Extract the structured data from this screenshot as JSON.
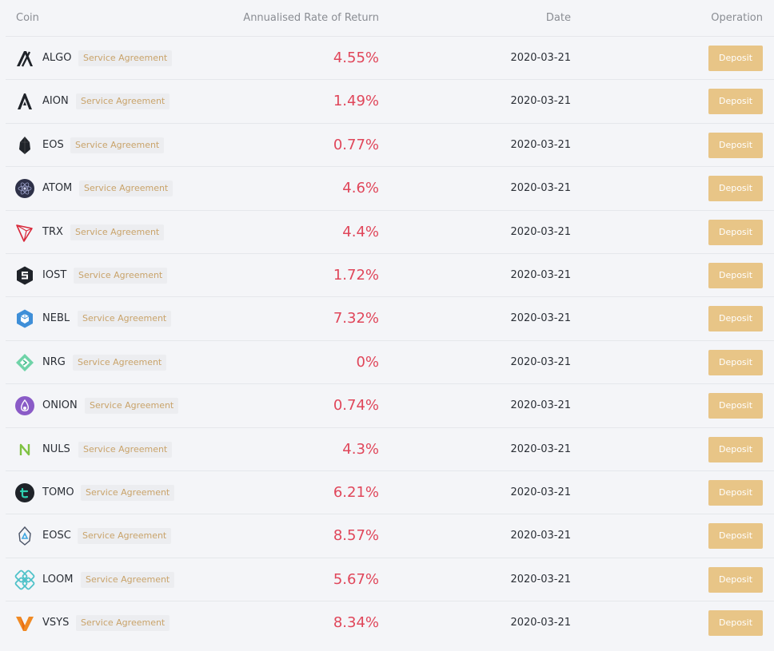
{
  "header": {
    "coin": "Coin",
    "rate": "Annualised Rate of Return",
    "date": "Date",
    "operation": "Operation"
  },
  "colors": {
    "rate": "#e0465a",
    "deposit_button": "#e8c587",
    "agreement_text": "#c9a36a",
    "agreement_bg": "#ecedf0"
  },
  "rows": [
    {
      "coin": "ALGO",
      "icon": "algo-icon",
      "agreement": "Service Agreement",
      "rate": "4.55%",
      "date": "2020-03-21",
      "deposit": "Deposit"
    },
    {
      "coin": "AION",
      "icon": "aion-icon",
      "agreement": "Service Agreement",
      "rate": "1.49%",
      "date": "2020-03-21",
      "deposit": "Deposit"
    },
    {
      "coin": "EOS",
      "icon": "eos-icon",
      "agreement": "Service Agreement",
      "rate": "0.77%",
      "date": "2020-03-21",
      "deposit": "Deposit"
    },
    {
      "coin": "ATOM",
      "icon": "atom-icon",
      "agreement": "Service Agreement",
      "rate": "4.6%",
      "date": "2020-03-21",
      "deposit": "Deposit"
    },
    {
      "coin": "TRX",
      "icon": "trx-icon",
      "agreement": "Service Agreement",
      "rate": "4.4%",
      "date": "2020-03-21",
      "deposit": "Deposit"
    },
    {
      "coin": "IOST",
      "icon": "iost-icon",
      "agreement": "Service Agreement",
      "rate": "1.72%",
      "date": "2020-03-21",
      "deposit": "Deposit"
    },
    {
      "coin": "NEBL",
      "icon": "nebl-icon",
      "agreement": "Service Agreement",
      "rate": "7.32%",
      "date": "2020-03-21",
      "deposit": "Deposit"
    },
    {
      "coin": "NRG",
      "icon": "nrg-icon",
      "agreement": "Service Agreement",
      "rate": "0%",
      "date": "2020-03-21",
      "deposit": "Deposit"
    },
    {
      "coin": "ONION",
      "icon": "onion-icon",
      "agreement": "Service Agreement",
      "rate": "0.74%",
      "date": "2020-03-21",
      "deposit": "Deposit"
    },
    {
      "coin": "NULS",
      "icon": "nuls-icon",
      "agreement": "Service Agreement",
      "rate": "4.3%",
      "date": "2020-03-21",
      "deposit": "Deposit"
    },
    {
      "coin": "TOMO",
      "icon": "tomo-icon",
      "agreement": "Service Agreement",
      "rate": "6.21%",
      "date": "2020-03-21",
      "deposit": "Deposit"
    },
    {
      "coin": "EOSC",
      "icon": "eosc-icon",
      "agreement": "Service Agreement",
      "rate": "8.57%",
      "date": "2020-03-21",
      "deposit": "Deposit"
    },
    {
      "coin": "LOOM",
      "icon": "loom-icon",
      "agreement": "Service Agreement",
      "rate": "5.67%",
      "date": "2020-03-21",
      "deposit": "Deposit"
    },
    {
      "coin": "VSYS",
      "icon": "vsys-icon",
      "agreement": "Service Agreement",
      "rate": "8.34%",
      "date": "2020-03-21",
      "deposit": "Deposit"
    }
  ]
}
